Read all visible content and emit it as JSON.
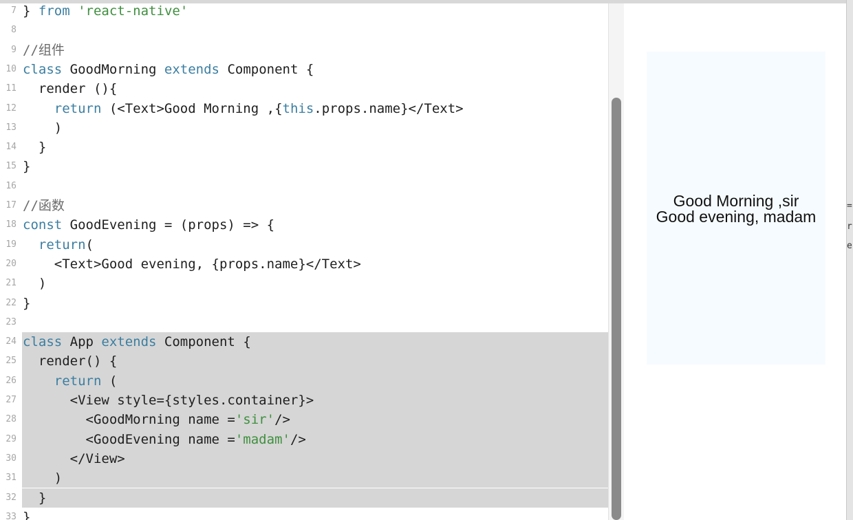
{
  "editor": {
    "lines": [
      {
        "num": "7",
        "tokens": [
          {
            "t": "} ",
            "c": "plain"
          },
          {
            "t": "from",
            "c": "kw"
          },
          {
            "t": " ",
            "c": "plain"
          },
          {
            "t": "'react-native'",
            "c": "str"
          }
        ]
      },
      {
        "num": "8",
        "tokens": []
      },
      {
        "num": "9",
        "tokens": [
          {
            "t": "//组件",
            "c": "cm"
          }
        ]
      },
      {
        "num": "10",
        "tokens": [
          {
            "t": "class",
            "c": "kw"
          },
          {
            "t": " GoodMorning ",
            "c": "plain"
          },
          {
            "t": "extends",
            "c": "kw"
          },
          {
            "t": " Component {",
            "c": "plain"
          }
        ]
      },
      {
        "num": "11",
        "tokens": [
          {
            "t": "  render (){",
            "c": "plain"
          }
        ]
      },
      {
        "num": "12",
        "tokens": [
          {
            "t": "    ",
            "c": "plain"
          },
          {
            "t": "return",
            "c": "kw"
          },
          {
            "t": " (<Text>Good Morning ,{",
            "c": "plain"
          },
          {
            "t": "this",
            "c": "kw"
          },
          {
            "t": ".props.name}</Text>",
            "c": "plain"
          }
        ]
      },
      {
        "num": "13",
        "tokens": [
          {
            "t": "    )",
            "c": "plain"
          }
        ]
      },
      {
        "num": "14",
        "tokens": [
          {
            "t": "  }",
            "c": "plain"
          }
        ]
      },
      {
        "num": "15",
        "tokens": [
          {
            "t": "}",
            "c": "plain"
          }
        ]
      },
      {
        "num": "16",
        "tokens": []
      },
      {
        "num": "17",
        "tokens": [
          {
            "t": "//函数",
            "c": "cm"
          }
        ]
      },
      {
        "num": "18",
        "tokens": [
          {
            "t": "const",
            "c": "kw"
          },
          {
            "t": " GoodEvening = (props) => {",
            "c": "plain"
          }
        ]
      },
      {
        "num": "19",
        "tokens": [
          {
            "t": "  ",
            "c": "plain"
          },
          {
            "t": "return",
            "c": "kw"
          },
          {
            "t": "(",
            "c": "plain"
          }
        ]
      },
      {
        "num": "20",
        "tokens": [
          {
            "t": "    <Text>Good evening, {props.name}</Text>",
            "c": "plain"
          }
        ]
      },
      {
        "num": "21",
        "tokens": [
          {
            "t": "  )",
            "c": "plain"
          }
        ]
      },
      {
        "num": "22",
        "tokens": [
          {
            "t": "}",
            "c": "plain"
          }
        ]
      },
      {
        "num": "23",
        "tokens": []
      },
      {
        "num": "24",
        "sel": true,
        "tokens": [
          {
            "t": "class",
            "c": "kw"
          },
          {
            "t": " App ",
            "c": "plain"
          },
          {
            "t": "extends",
            "c": "kw"
          },
          {
            "t": " Component {",
            "c": "plain"
          }
        ]
      },
      {
        "num": "25",
        "sel": true,
        "tokens": [
          {
            "t": "  render() {",
            "c": "plain"
          }
        ]
      },
      {
        "num": "26",
        "sel": true,
        "tokens": [
          {
            "t": "    ",
            "c": "plain"
          },
          {
            "t": "return",
            "c": "kw"
          },
          {
            "t": " (",
            "c": "plain"
          }
        ]
      },
      {
        "num": "27",
        "sel": true,
        "tokens": [
          {
            "t": "      <View style={styles.container}>",
            "c": "plain"
          }
        ]
      },
      {
        "num": "28",
        "sel": true,
        "tokens": [
          {
            "t": "        <GoodMorning name =",
            "c": "plain"
          },
          {
            "t": "'sir'",
            "c": "str"
          },
          {
            "t": "/>",
            "c": "plain"
          }
        ]
      },
      {
        "num": "29",
        "sel": true,
        "tokens": [
          {
            "t": "        <GoodEvening name =",
            "c": "plain"
          },
          {
            "t": "'madam'",
            "c": "str"
          },
          {
            "t": "/>",
            "c": "plain"
          }
        ]
      },
      {
        "num": "30",
        "sel": true,
        "tokens": [
          {
            "t": "      </View>",
            "c": "plain"
          }
        ]
      },
      {
        "num": "31",
        "sel": true,
        "tokens": [
          {
            "t": "    )",
            "c": "plain"
          }
        ]
      },
      {
        "num": "32",
        "sel": true,
        "tokens": [
          {
            "t": "  }",
            "c": "plain"
          }
        ]
      },
      {
        "num": "33",
        "tokens": [
          {
            "t": "}",
            "c": "plain"
          }
        ]
      }
    ]
  },
  "preview": {
    "line1": "Good Morning ,sir",
    "line2": "Good evening, madam"
  },
  "right_edge": {
    "glyphs": [
      "=",
      "r",
      "e"
    ]
  },
  "colors": {
    "keyword": "#3b7ea1",
    "string": "#3f8f3f",
    "selection": "#d6d6d6",
    "preview_bg": "#f6fbff"
  }
}
